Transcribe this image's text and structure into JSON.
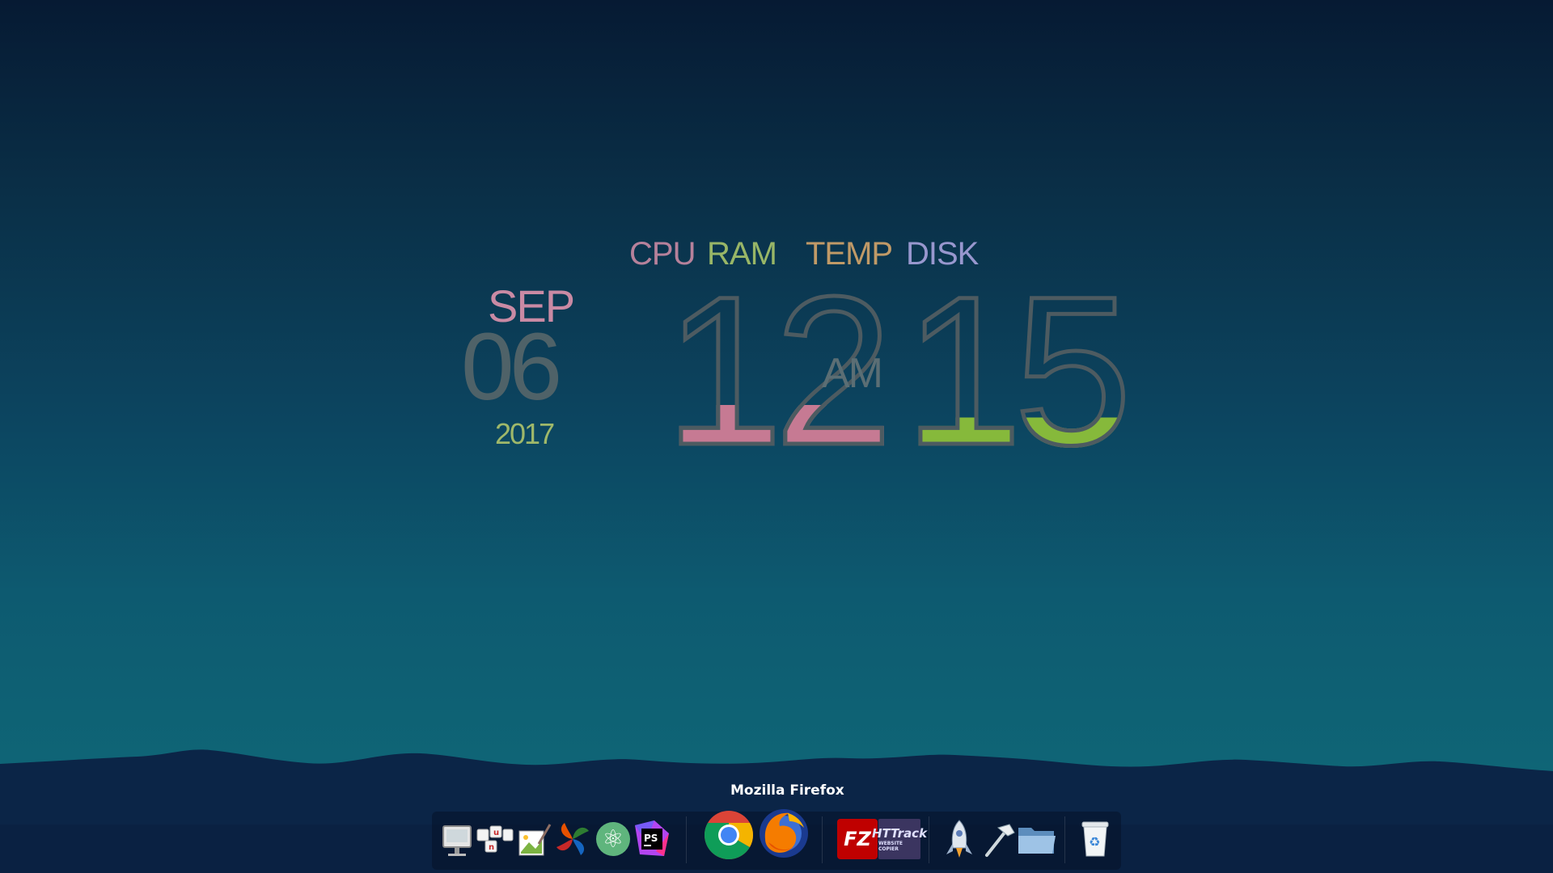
{
  "widget": {
    "stats": {
      "cpu": {
        "label": "CPU",
        "color": "#c98aa4"
      },
      "ram": {
        "label": "RAM",
        "color": "#a8c46a"
      },
      "temp": {
        "label": "TEMP",
        "color": "#d4a56a"
      },
      "disk": {
        "label": "DISK",
        "color": "#a8a2dc"
      }
    },
    "date": {
      "month": "SEP",
      "day": "06",
      "year": "2017"
    },
    "time": {
      "hours": "12",
      "ampm": "AM",
      "minutes": "15"
    }
  },
  "dock": {
    "tooltip": "Mozilla Firefox",
    "apps": [
      {
        "icon": "system-preferences-icon"
      },
      {
        "icon": "unity-tweak-icon",
        "text": "u n"
      },
      {
        "icon": "image-editor-icon"
      },
      {
        "icon": "pinwheel-app-icon"
      },
      {
        "icon": "atom-editor-icon",
        "glyph": "⚛"
      },
      {
        "icon": "phpstorm-icon",
        "text": "PS"
      },
      {
        "icon": "chrome-icon"
      },
      {
        "icon": "firefox-icon"
      },
      {
        "icon": "filezilla-icon",
        "text": "FZ"
      },
      {
        "icon": "httrack-icon",
        "text": "HTTrack",
        "subtext": "WEBSITE COPIER"
      },
      {
        "icon": "rocket-launcher-icon"
      },
      {
        "icon": "hammer-icon"
      },
      {
        "icon": "folder-icon"
      },
      {
        "icon": "trash-icon",
        "glyph": "♻"
      }
    ]
  }
}
